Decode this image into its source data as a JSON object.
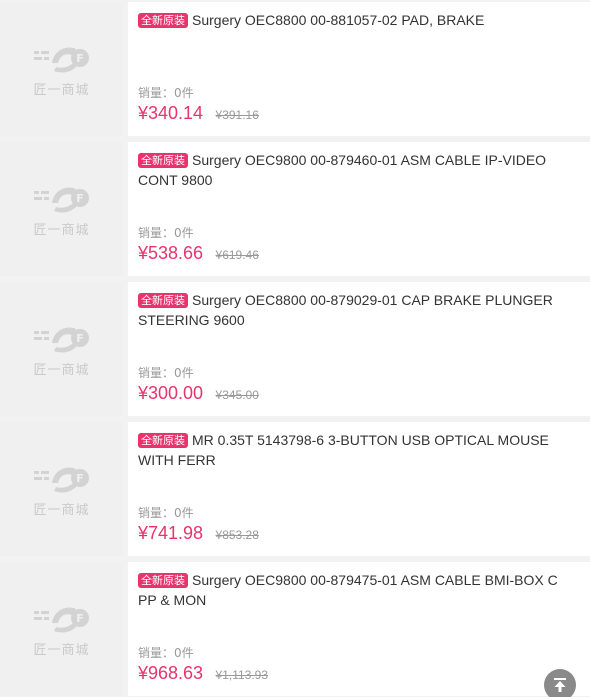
{
  "brand_text": "匠一商城",
  "sales_label": "销量：",
  "tag_label": "全新原装",
  "products": [
    {
      "title": "Surgery OEC8800 00-881057-02 PAD, BRAKE",
      "sales": "0件",
      "price": "¥340.14",
      "original_price": "¥391.16"
    },
    {
      "title": "Surgery OEC9800 00-879460-01 ASM CABLE IP-VIDEO CONT 9800",
      "sales": "0件",
      "price": "¥538.66",
      "original_price": "¥619.46"
    },
    {
      "title": "Surgery OEC8800 00-879029-01 CAP BRAKE PLUNGER STEERING 9600",
      "sales": "0件",
      "price": "¥300.00",
      "original_price": "¥345.00"
    },
    {
      "title": "MR 0.35T 5143798-6 3-BUTTON USB OPTICAL MOUSE WITH FERR",
      "sales": "0件",
      "price": "¥741.98",
      "original_price": "¥853.28"
    },
    {
      "title": "Surgery OEC9800 00-879475-01 ASM CABLE BMI-BOX C PP & MON",
      "sales": "0件",
      "price": "¥968.63",
      "original_price": "¥1,113.93"
    }
  ],
  "back_to_top_icon": "arrow-up-to-top-icon",
  "colors": {
    "accent": "#e8336c",
    "muted": "#999999"
  }
}
